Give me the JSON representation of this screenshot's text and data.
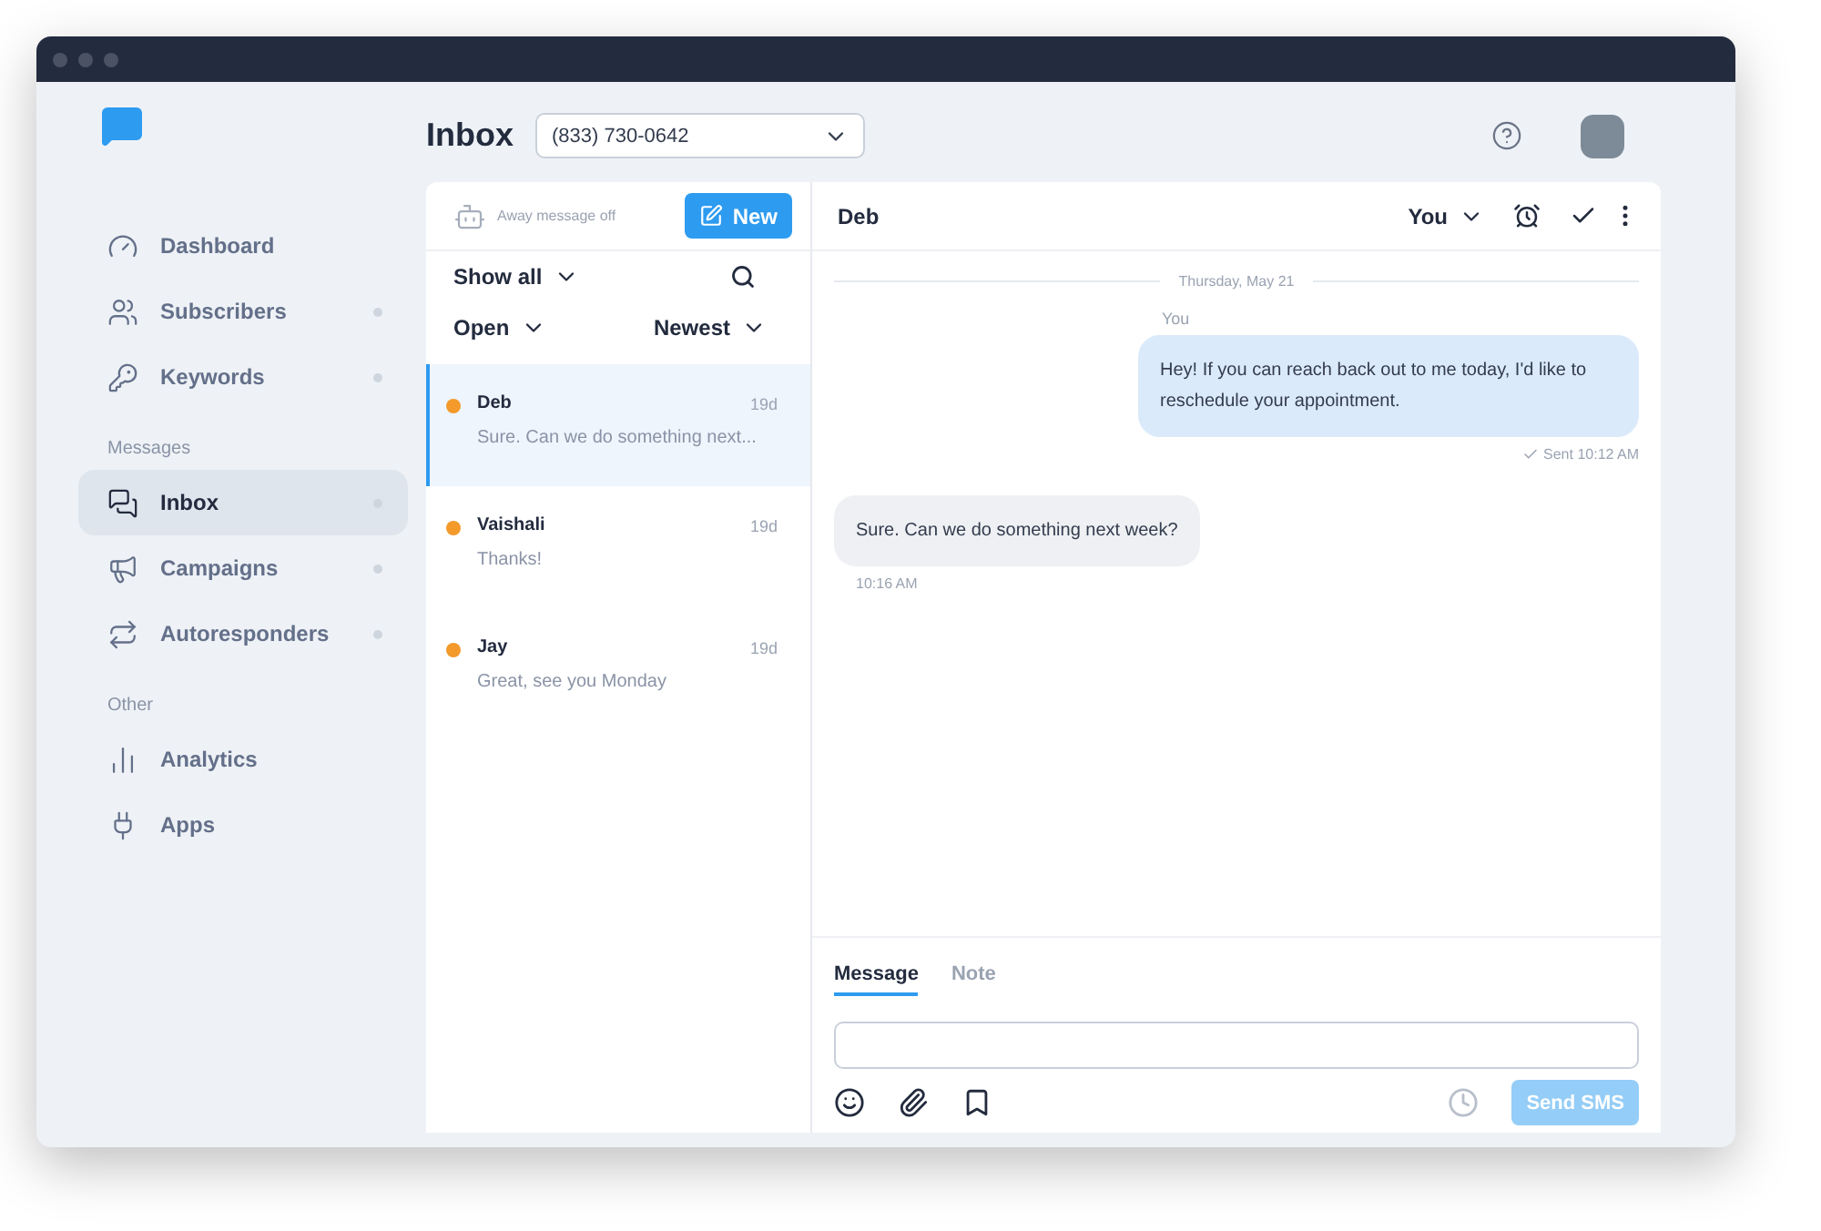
{
  "header": {
    "title": "Inbox",
    "phone_select": {
      "value": "(833) 730-0642"
    }
  },
  "sidebar": {
    "groups": [
      {
        "items": [
          {
            "label": "Dashboard",
            "selected": false,
            "dot": false
          },
          {
            "label": "Subscribers",
            "selected": false,
            "dot": true
          },
          {
            "label": "Keywords",
            "selected": false,
            "dot": true
          }
        ]
      },
      {
        "heading": "Messages",
        "items": [
          {
            "label": "Inbox",
            "selected": true,
            "dot": true
          },
          {
            "label": "Campaigns",
            "selected": false,
            "dot": true
          },
          {
            "label": "Autoresponders",
            "selected": false,
            "dot": true
          }
        ]
      },
      {
        "heading": "Other",
        "items": [
          {
            "label": "Analytics",
            "selected": false,
            "dot": false
          },
          {
            "label": "Apps",
            "selected": false,
            "dot": false
          }
        ]
      }
    ]
  },
  "conversation_list": {
    "away_message": "Away message off",
    "new_button": "New",
    "filter": "Show all",
    "status_filter": "Open",
    "sort": "Newest",
    "items": [
      {
        "name": "Deb",
        "time": "19d",
        "preview": "Sure. Can we do something next...",
        "selected": true,
        "unread": true
      },
      {
        "name": "Vaishali",
        "time": "19d",
        "preview": "Thanks!",
        "selected": false,
        "unread": true
      },
      {
        "name": "Jay",
        "time": "19d",
        "preview": "Great, see you Monday",
        "selected": false,
        "unread": true
      }
    ]
  },
  "chat": {
    "contact": "Deb",
    "assignee": "You",
    "date": "Thursday, May 21",
    "messages": [
      {
        "kind": "outgoing",
        "sender": "You",
        "text": "Hey! If you can reach back out to me today, I'd like to reschedule your appointment.",
        "status": "Sent 10:12 AM"
      },
      {
        "kind": "incoming",
        "text": "Sure. Can we do something next week?",
        "status": "10:16 AM"
      }
    ],
    "composer_tabs": [
      {
        "label": "Message",
        "selected": true
      },
      {
        "label": "Note",
        "selected": false
      }
    ],
    "send_button": {
      "label": "Send SMS",
      "disabled": true
    }
  }
}
